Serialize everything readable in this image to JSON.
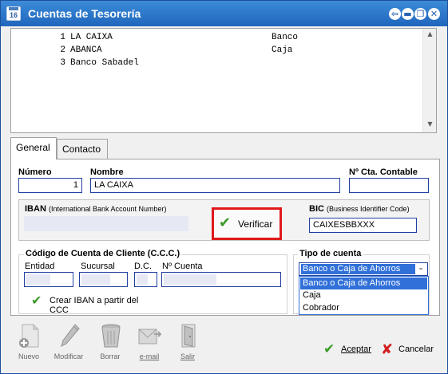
{
  "window": {
    "icon_text": "16",
    "title": "Cuentas de Tesorería",
    "controls": {
      "back": "⇦",
      "minimize": "▬",
      "maximize": "❐",
      "close": "✕"
    }
  },
  "list": {
    "rows": [
      {
        "num": "1",
        "name": "LA CAIXA",
        "type": "Banco"
      },
      {
        "num": "2",
        "name": "ABANCA",
        "type": "Caja"
      },
      {
        "num": "3",
        "name": "Banco Sabadel",
        "type": ""
      }
    ]
  },
  "tabs": {
    "general": "General",
    "contacto": "Contacto"
  },
  "form": {
    "numero_label": "Número",
    "numero_value": "1",
    "nombre_label": "Nombre",
    "nombre_value": "LA CAIXA",
    "cta_contable_label": "Nº Cta. Contable",
    "cta_contable_value": "",
    "iban_label": "IBAN",
    "iban_hint": "(International Bank Account Number)",
    "verificar_label": "Verificar",
    "bic_label": "BIC",
    "bic_hint": "(Business Identifier Code)",
    "bic_value": "CAIXESBBXXX",
    "ccc_legend": "Código de Cuenta de Cliente (C.C.C.)",
    "entidad_label": "Entidad",
    "sucursal_label": "Sucursal",
    "dc_label": "D.C.",
    "cuenta_label": "Nº Cuenta",
    "crear_iban_label": "Crear IBAN a partir del CCC",
    "tipo_legend": "Tipo de cuenta",
    "tipo_selected": "Banco o Caja de Ahorros",
    "tipo_options": [
      "Banco o Caja de Ahorros",
      "Caja",
      "Cobrador"
    ]
  },
  "toolbar": {
    "nuevo": "Nuevo",
    "modificar": "Modificar",
    "borrar": "Borrar",
    "email": "e-mail",
    "salir": "Salir"
  },
  "buttons": {
    "aceptar": "Aceptar",
    "cancelar": "Cancelar"
  },
  "icons": {
    "check": "✔",
    "cross": "✘",
    "scroll_up": "▲",
    "scroll_down": "▼",
    "caret": "⌄"
  },
  "colors": {
    "titlebar": "#1f66bd",
    "highlight_red": "#e0191b",
    "selection_blue": "#3070d8",
    "check_green": "#3c9b2a"
  }
}
